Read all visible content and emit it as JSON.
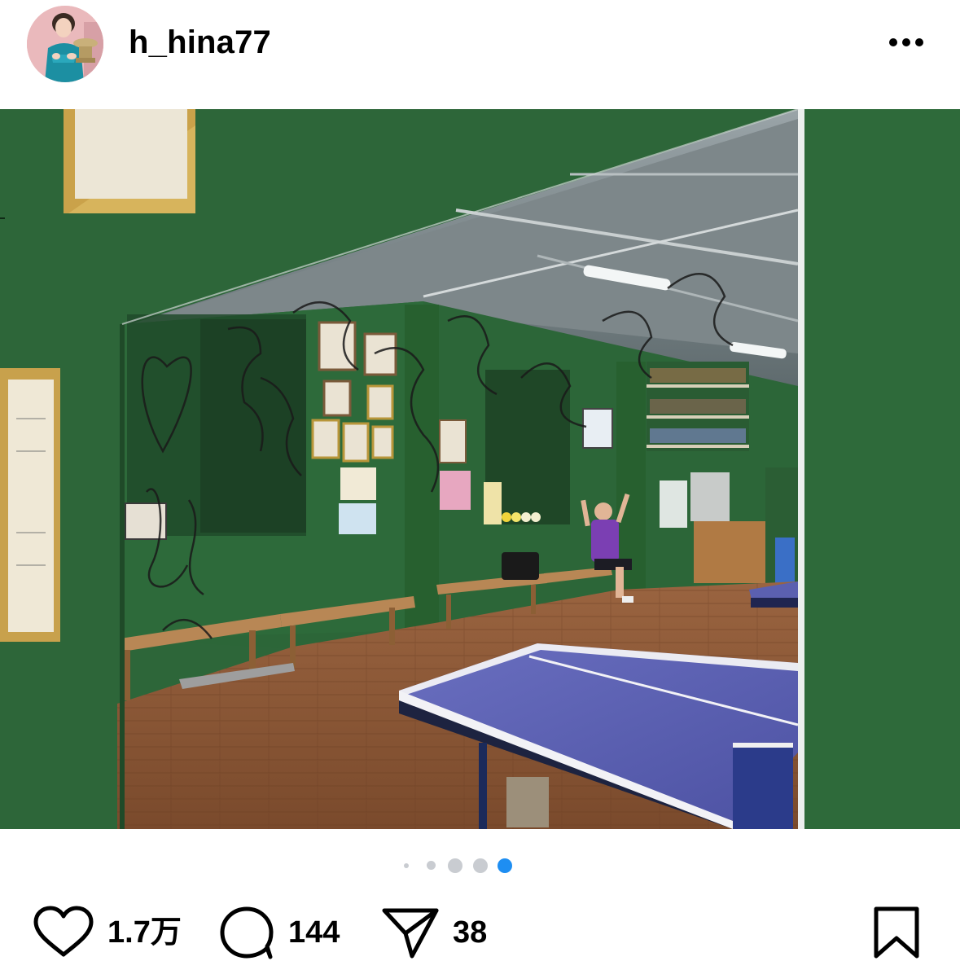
{
  "header": {
    "username": "h_hina77",
    "avatar_icon": "profile-avatar",
    "more_icon": "more-horizontal-icon"
  },
  "post": {
    "image_icon": "post-photo",
    "carousel": {
      "count": 5,
      "active_index": 4,
      "active_color": "#1e8ef2",
      "inactive_color": "#c9ccd1"
    }
  },
  "actions": {
    "like_icon": "heart-icon",
    "like_count": "1.7万",
    "comment_icon": "comment-icon",
    "comment_count": "144",
    "share_icon": "paper-plane-icon",
    "share_count": "38",
    "save_icon": "bookmark-icon"
  },
  "colors": {
    "wall_green": "#2e6b3b",
    "floor_brown": "#8a5634",
    "table_blue": "#5a5fb0",
    "accent_blue": "#1e8ef2"
  }
}
